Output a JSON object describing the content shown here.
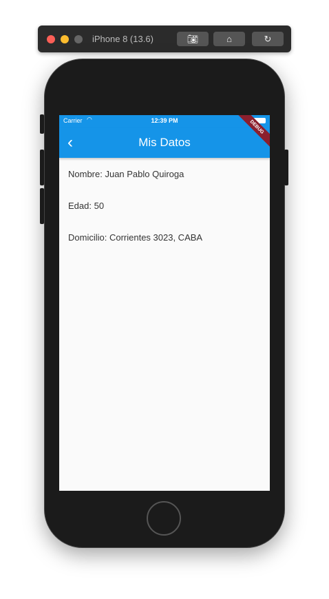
{
  "simulator": {
    "title": "iPhone 8 (13.6)",
    "buttons": [
      "screenshot-icon",
      "home-icon",
      "rotate-icon"
    ]
  },
  "status": {
    "carrier": "Carrier",
    "time": "12:39 PM"
  },
  "appbar": {
    "title": "Mis Datos",
    "back": "‹",
    "debug": "DEBUG"
  },
  "content": {
    "rows": [
      "Nombre: Juan Pablo Quiroga",
      "Edad: 50",
      "Domicilio: Corrientes 3023, CABA"
    ]
  },
  "colors": {
    "accent": "#1594e8"
  }
}
